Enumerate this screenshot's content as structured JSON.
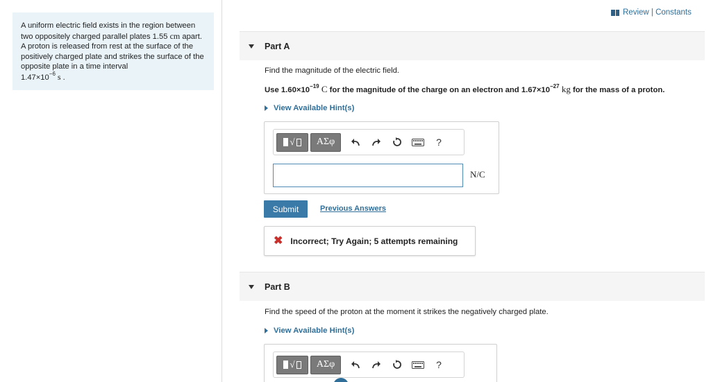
{
  "header": {
    "review_label": "Review | Constants"
  },
  "intro": {
    "text_1": "A uniform electric field exists in the region between two oppositely charged parallel plates 1.55 ",
    "unit_cm": "cm",
    "text_2": " apart. A proton is released from rest at the surface of the positively charged plate and strikes the surface of the opposite plate in a time interval",
    "time_mantissa": "1.47×10",
    "time_exp": "−6",
    "time_unit": " s",
    "period": " ."
  },
  "part_a": {
    "label": "Part A",
    "question": "Find the magnitude of the electric field.",
    "given_1": "Use 1.60×10",
    "given_exp1": "−19",
    "given_unit_c": " C",
    "given_2": " for the magnitude of the charge on an electron and 1.67×10",
    "given_exp2": "−27",
    "given_unit_kg": " kg",
    "given_3": " for the mass of a proton.",
    "hint_label": "View Available Hint(s)",
    "greek_label": "ΑΣφ",
    "help_label": "?",
    "input_value": "",
    "unit": "N/C",
    "submit_label": "Submit",
    "prev_answers_label": "Previous Answers",
    "feedback_icon": "✖",
    "feedback_text": "Incorrect; Try Again; 5 attempts remaining"
  },
  "part_b": {
    "label": "Part B",
    "question": "Find the speed of the proton at the moment it strikes the negatively charged plate.",
    "hint_label": "View Available Hint(s)",
    "greek_label": "ΑΣφ",
    "help_label": "?"
  },
  "colors": {
    "link": "#2f6f99",
    "submit": "#3a7aa8",
    "intro_bg": "#eaf4f8",
    "incorrect": "#c9302c"
  }
}
